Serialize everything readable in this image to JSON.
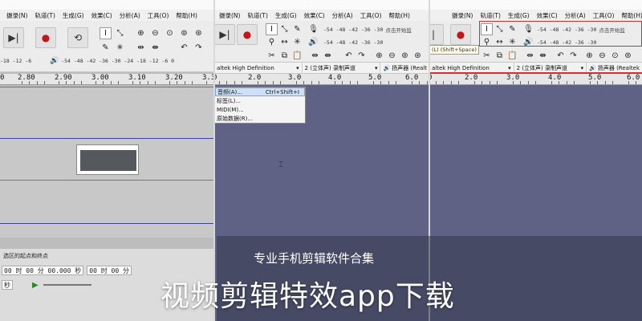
{
  "panel1": {
    "menu": [
      "摄录(N)",
      "轨道(T)",
      "生成(G)",
      "效果(C)",
      "分析(A)",
      "工具(O)",
      "帮助(H)"
    ],
    "meter": {
      "left": "-18 -12 -6",
      "right": "-54 -48 -42 -36 -30 -24 -18 -12 -6 0"
    },
    "ruler": [
      "2.80",
      "2.90",
      "3.00",
      "3.10",
      "3.20",
      "3.30"
    ],
    "ruler_left": "0",
    "selection_label": "选区的起点和终点",
    "time_text": "00 时 00 分 00.000 秒",
    "time_text2": "00 时 00 分",
    "seconds_label": "秒"
  },
  "panel2": {
    "menu": [
      "摄录(N)",
      "轨道(T)",
      "生成(G)",
      "效果(C)",
      "分析(A)",
      "工具(O)",
      "帮助(H)"
    ],
    "meter_top": "-54 -48 -42 -36 -30",
    "meter_top_label": "点击开始监",
    "meter_bottom": "-54 -48 -42 -36 -30",
    "device": "altek High Definition",
    "channels": "2 (立体声) 录制声道",
    "speaker": "扬声器 (Realt",
    "ruler": [
      "0",
      "2.0",
      "3.0",
      "4.0",
      "5.0",
      "6.0"
    ],
    "dropdown": [
      {
        "label": "音频(A)...",
        "accel": "Ctrl+Shift+I"
      },
      {
        "label": "标签(L)...",
        "accel": ""
      },
      {
        "label": "MIDI(M)...",
        "accel": ""
      },
      {
        "label": "原始数据(R)...",
        "accel": ""
      }
    ]
  },
  "panel3": {
    "menu": [
      "摄录(N)",
      "轨道(T)",
      "生成(G)",
      "效果(C)",
      "分析(A)",
      "工具(O)",
      "帮助(H)"
    ],
    "meter_top": "-54 -48 -42 -36 -30",
    "meter_top_label": "点击开始监",
    "meter_bottom": "-54 -48 -42 -36 -30",
    "tooltip": "(L) (Shift+Space)",
    "device": "altek High Definition",
    "channels": "2 (立体声) 录制声道",
    "speaker": "扬声器 (Realtek",
    "ruler": [
      "0",
      "2.0",
      "3.0",
      "4.0",
      "5.0",
      "6.0"
    ]
  },
  "overlay": {
    "subtitle": "专业手机剪辑软件合集",
    "title": "视频剪辑特效app下载"
  },
  "colors": {
    "waveform": "#3a3fa0",
    "highlight": "#d23030",
    "track_bg": "#5f6284"
  }
}
